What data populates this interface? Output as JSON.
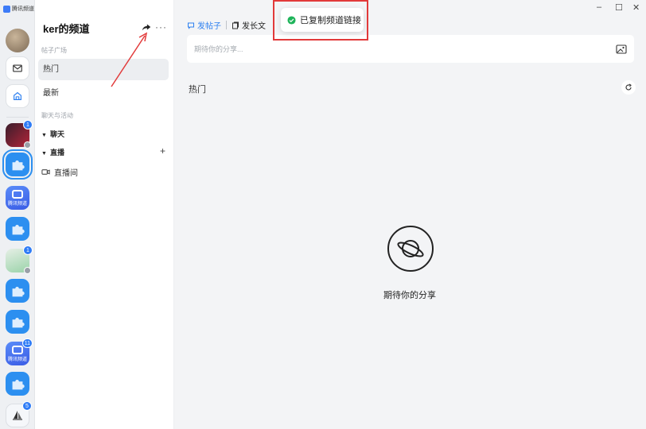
{
  "app": {
    "brand_name": "腾讯频道"
  },
  "rail": {
    "badges": {
      "game": "1",
      "photo": "1",
      "official": "11",
      "boat": "5"
    },
    "official_tile_label": "腾讯频道"
  },
  "sidebar": {
    "channel_title": "ker的频道",
    "section_posts": "帖子广场",
    "items": [
      {
        "label": "热门"
      },
      {
        "label": "最新"
      }
    ],
    "section_chat": "聊天与活动",
    "group_chat": "聊天",
    "group_live": "直播",
    "live_room": "直播间"
  },
  "main": {
    "tab_post": "发帖子",
    "tab_article": "发长文",
    "composer_placeholder": "期待你的分享...",
    "feed_title": "热门",
    "empty_text": "期待你的分享"
  },
  "toast": {
    "message": "已复制频道链接"
  },
  "colors": {
    "accent": "#2c7ff0",
    "annotation": "#e23a3a",
    "success": "#1fb45a"
  }
}
